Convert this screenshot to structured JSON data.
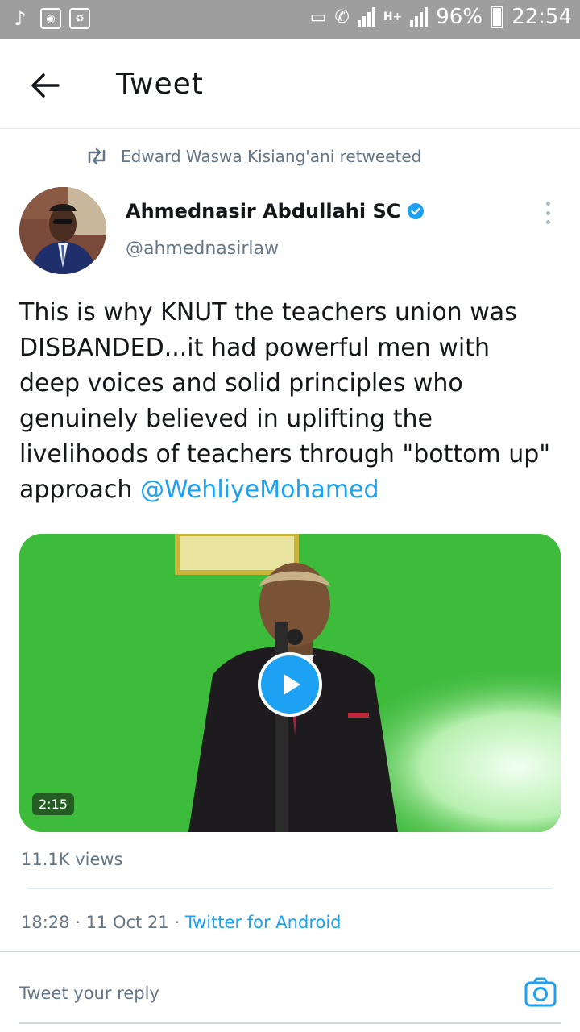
{
  "status_bar": {
    "signal_label": "H+",
    "battery": "96%",
    "time": "22:54"
  },
  "app_bar": {
    "title": "Tweet"
  },
  "retweet": {
    "text": "Edward Waswa Kisiang'ani retweeted"
  },
  "author": {
    "name": "Ahmednasir Abdullahi SC",
    "handle": "@ahmednasirlaw",
    "verified": true
  },
  "tweet": {
    "text": "This is why KNUT the teachers union was DISBANDED...it had powerful men with deep voices and solid principles who genuinely believed in uplifting the livelihoods of teachers through \"bottom up\" approach ",
    "mention": "@WehliyeMohamed"
  },
  "video": {
    "duration": "2:15"
  },
  "stats": {
    "views": "11.1K views"
  },
  "meta": {
    "time": "18:28",
    "separator": " · ",
    "date": "11 Oct 21",
    "source": "Twitter for Android"
  },
  "reply": {
    "placeholder": "Tweet your reply"
  },
  "colors": {
    "accent": "#1da1f2",
    "secondary_text": "#657786",
    "status_bar": "#9e9e9e"
  }
}
